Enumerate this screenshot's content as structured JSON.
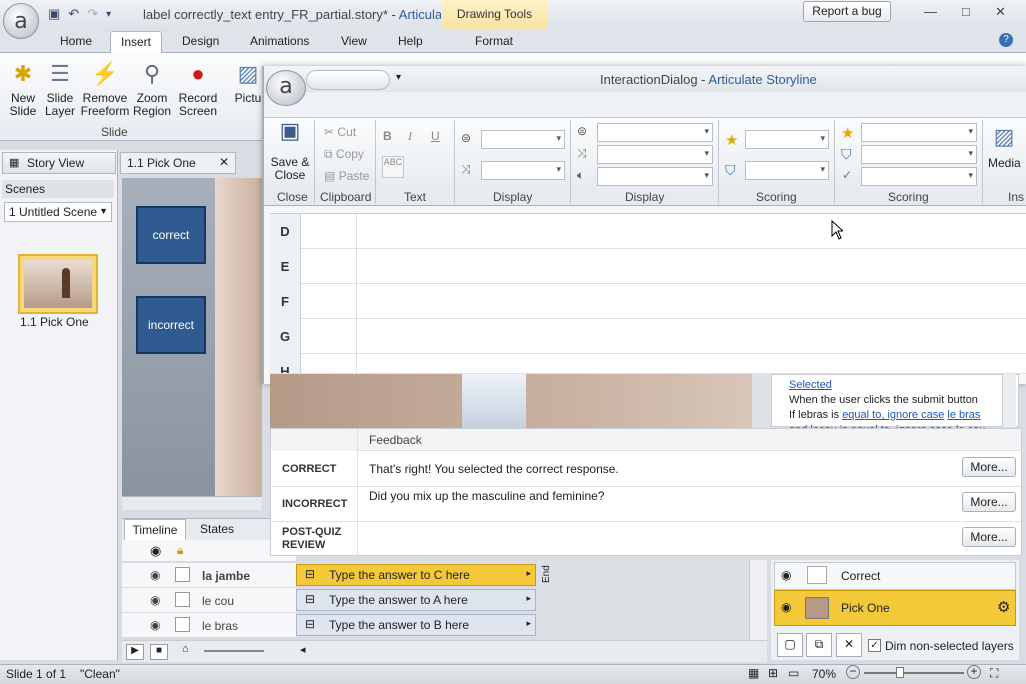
{
  "window": {
    "title_prefix": "label correctly_text entry_FR_partial.story* - ",
    "title_app": "Articulate",
    "contextual_tab_group": "Drawing Tools",
    "report_bug": "Report a bug",
    "logo_letter": "a"
  },
  "tabs": [
    "Home",
    "Insert",
    "Design",
    "Animations",
    "View",
    "Help",
    "Format"
  ],
  "active_tab": "Insert",
  "ribbon": {
    "new_slide": "New Slide",
    "slide_layer": "Slide Layer",
    "remove_freeform": "Remove Freeform",
    "zoom_region": "Zoom Region",
    "record_screen": "Record Screen",
    "group_slide": "Slide",
    "picture": "Pictu"
  },
  "story_panel": {
    "story_view_tab": "Story View",
    "slide_tab": "1.1 Pick One",
    "scenes_label": "Scenes",
    "scene_dropdown": "1 Untitled Scene",
    "slide_thumb_label": "1.1 Pick One"
  },
  "slide": {
    "btn_correct": "correct",
    "btn_incorrect": "incorrect"
  },
  "timeline": {
    "tab_timeline": "Timeline",
    "tab_states": "States",
    "rows": [
      "la jambe",
      "le cou",
      "le bras"
    ],
    "items": [
      "Type the answer to C here",
      "Type the answer to A here",
      "Type the answer to B here"
    ],
    "end_label": "End"
  },
  "dialog": {
    "title": "InteractionDialog",
    "title_sep": " - ",
    "title_app": "Articulate Storyline",
    "logo_letter": "a",
    "close_group": {
      "button": "Save & Close",
      "label": "Close"
    },
    "clipboard": {
      "cut": "Cut",
      "copy": "Copy",
      "paste": "Paste",
      "label": "Clipboard"
    },
    "text_group": {
      "bold": "B",
      "italic": "I",
      "underline": "U",
      "label": "Text"
    },
    "display1_label": "Display",
    "display2_label": "Display",
    "scoring1_label": "Scoring",
    "scoring2_label": "Scoring",
    "media_label": "Media",
    "ins_label": "Ins"
  },
  "grid_rows": [
    "D",
    "E",
    "F",
    "G",
    "H"
  ],
  "trigger": {
    "line1": "Selected",
    "line2": "When the user clicks the submit button",
    "line3_prefix": "If lebras is ",
    "line3_link1": "equal to, ignore case",
    "line3_link2": "le bras",
    "line4": "and lecou is equal to, ignore case le cou"
  },
  "feedback": {
    "header": "Feedback",
    "rows": [
      {
        "label": "CORRECT",
        "text": "That's right!  You selected the correct response.",
        "more": "More..."
      },
      {
        "label": "INCORRECT",
        "text": "Did you mix up the masculine and feminine?",
        "more": "More..."
      },
      {
        "label": "POST-QUIZ REVIEW",
        "text": "",
        "more": "More..."
      }
    ]
  },
  "layers": {
    "correct": "Correct",
    "pick_one": "Pick One",
    "dim_label": "Dim non-selected layers"
  },
  "status": {
    "slide_count": "Slide 1 of 1",
    "theme": "\"Clean\"",
    "zoom": "70%"
  },
  "colors": {
    "accent": "#2e5d9c",
    "selected_yellow": "#f3c93a",
    "slide_button": "#2f5b90"
  }
}
